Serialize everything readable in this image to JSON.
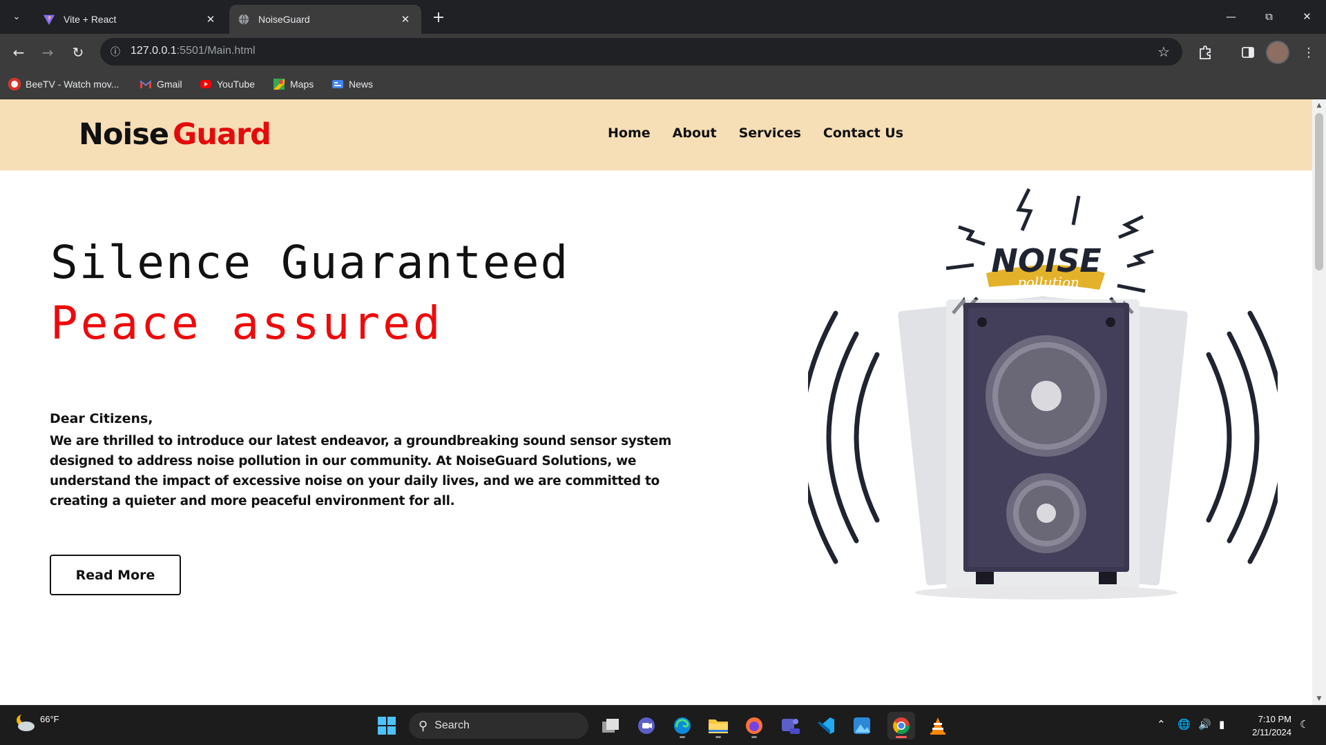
{
  "browser": {
    "tabs": [
      {
        "title": "Vite + React",
        "favicon": "vite-icon"
      },
      {
        "title": "NoiseGuard",
        "favicon": "globe-icon",
        "active": true
      }
    ],
    "url_host": "127.0.0.1",
    "url_path": ":5501/Main.html",
    "bookmarks": [
      {
        "label": "BeeTV - Watch mov...",
        "icon": "beetv-icon"
      },
      {
        "label": "Gmail",
        "icon": "gmail-icon"
      },
      {
        "label": "YouTube",
        "icon": "youtube-icon"
      },
      {
        "label": "Maps",
        "icon": "maps-icon"
      },
      {
        "label": "News",
        "icon": "news-icon"
      }
    ]
  },
  "site": {
    "logo_part1": "Noise",
    "logo_part2": "Guard",
    "nav": [
      "Home",
      "About",
      "Services",
      "Contact Us"
    ],
    "hero_line1": "Silence Guaranteed",
    "hero_line2": "Peace assured",
    "greeting": "Dear Citizens,",
    "paragraph": "We are thrilled to introduce our latest endeavor, a groundbreaking sound sensor system designed to address noise pollution in our community. At NoiseGuard Solutions, we understand the impact of excessive noise on your daily lives, and we are committed to creating a quieter and more peaceful environment for all.",
    "button": "Read More",
    "illustration": {
      "word1": "NOISE",
      "word2": "pollution"
    },
    "colors": {
      "accent": "#e30b0b",
      "navbar_bg": "#f6deb6"
    }
  },
  "taskbar": {
    "weather": "66°F",
    "search_placeholder": "Search",
    "time": "7:10 PM",
    "date": "2/11/2024"
  }
}
